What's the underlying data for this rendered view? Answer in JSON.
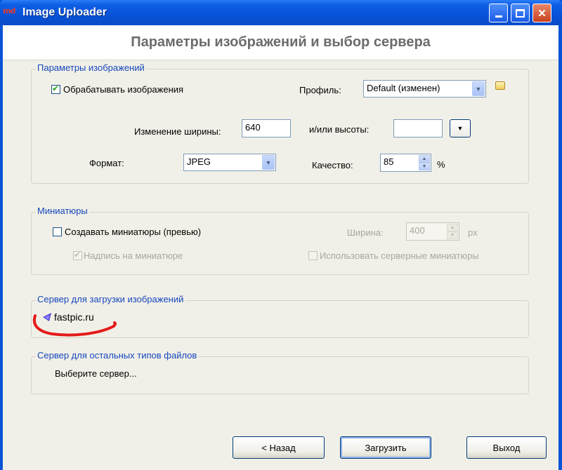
{
  "window": {
    "title": "Image Uploader",
    "app_icon_text": "md",
    "minimize_icon": "minimize-icon",
    "maximize_icon": "maximize-icon",
    "close_icon": "close-icon",
    "close_glyph": "✕"
  },
  "header": {
    "title": "Параметры изображений и выбор сервера"
  },
  "image_params": {
    "legend": "Параметры изображений",
    "process_label": "Обрабатывать изображения",
    "process_checked": true,
    "profile_label": "Профиль:",
    "profile_value": "Default (изменен)",
    "width_label": "Изменение ширины:",
    "width_value": "640",
    "height_label": "и/или высоты:",
    "height_value": "",
    "format_label": "Формат:",
    "format_value": "JPEG",
    "quality_label": "Качество:",
    "quality_value": "85",
    "quality_unit": "%"
  },
  "thumbnails": {
    "legend": "Миниатюры",
    "create_label": "Создавать миниатюры (превью)",
    "create_checked": false,
    "width_label": "Ширина:",
    "width_value": "400",
    "width_unit": "px",
    "caption_label": "Надпись на миниатюре",
    "caption_checked": true,
    "server_thumbs_label": "Использовать серверные миниатюры",
    "server_thumbs_checked": false
  },
  "image_server": {
    "legend": "Сервер для загрузки изображений",
    "server_name": "fastpic.ru"
  },
  "file_server": {
    "legend": "Сервер для остальных типов файлов",
    "placeholder": "Выберите сервер..."
  },
  "buttons": {
    "back": "< Назад",
    "upload": "Загрузить",
    "exit": "Выход"
  },
  "colors": {
    "titlebar": "#0752d8",
    "legend_text": "#1647bd",
    "annotation": "#e41b1b"
  }
}
